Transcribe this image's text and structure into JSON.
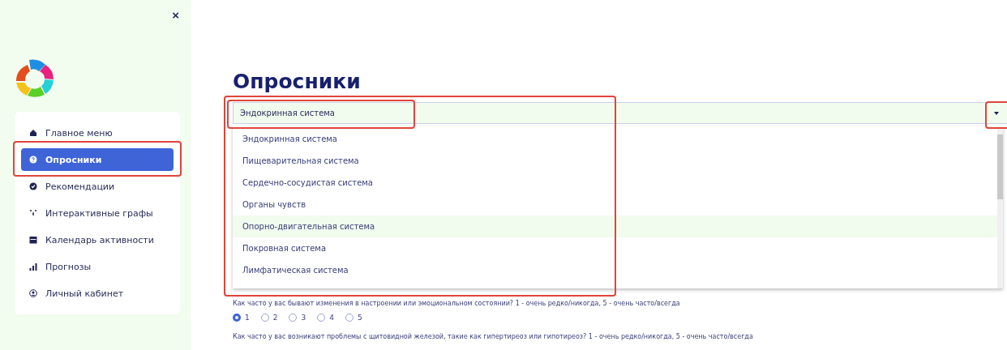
{
  "sidebar": {
    "close": "×",
    "items": [
      {
        "label": "Главное меню",
        "selected": false
      },
      {
        "label": "Опросники",
        "selected": true
      },
      {
        "label": "Рекомендации",
        "selected": false
      },
      {
        "label": "Интерактивные графы",
        "selected": false
      },
      {
        "label": "Календарь активности",
        "selected": false
      },
      {
        "label": "Прогнозы",
        "selected": false
      },
      {
        "label": "Личный кабинет",
        "selected": false
      }
    ]
  },
  "page_title": "Опросники",
  "combobox": {
    "value": "Эндокринная система",
    "expanded": true,
    "options": [
      {
        "label": "Эндокринная система",
        "highlighted": false
      },
      {
        "label": "Пищеварительная система",
        "highlighted": false
      },
      {
        "label": "Сердечно-сосудистая система",
        "highlighted": false
      },
      {
        "label": "Органы чувств",
        "highlighted": false
      },
      {
        "label": "Опорно-двигательная система",
        "highlighted": true
      },
      {
        "label": "Покровная система",
        "highlighted": false
      },
      {
        "label": "Лимфатическая система",
        "highlighted": false
      }
    ]
  },
  "questions": [
    {
      "text": "Как часто у вас бывают изменения в настроении или эмоциональном состоянии? 1 - очень редко/никогда, 5 - очень часто/всегда",
      "options": [
        {
          "label": "1",
          "selected": true
        },
        {
          "label": "2",
          "selected": false
        },
        {
          "label": "3",
          "selected": false
        },
        {
          "label": "4",
          "selected": false
        },
        {
          "label": "5",
          "selected": false
        }
      ]
    },
    {
      "text": "Как часто у вас возникают проблемы с щитовидной железой, такие как гипертиреоз или гипотиреоз? 1 - очень редко/никогда, 5 - очень часто/всегда"
    }
  ]
}
